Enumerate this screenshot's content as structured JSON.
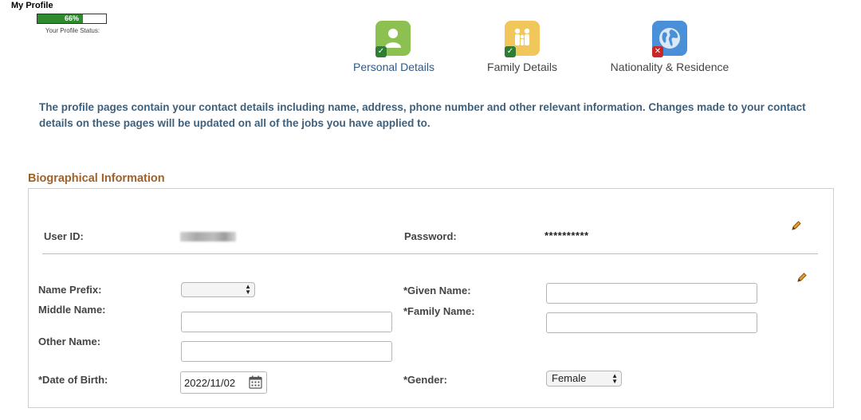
{
  "header": {
    "title": "My Profile",
    "progress_percent": 66,
    "progress_label": "66%",
    "status_label": "Your Profile Status:"
  },
  "steps": [
    {
      "label": "Personal Details",
      "icon": "person-icon",
      "status": "complete",
      "color": "#8cc152"
    },
    {
      "label": "Family Details",
      "icon": "family-icon",
      "status": "complete",
      "color": "#f1c75b"
    },
    {
      "label": "Nationality & Residence",
      "icon": "globe-icon",
      "status": "incomplete",
      "color": "#4a90d9"
    }
  ],
  "intro": "The profile pages contain your contact details including name, address, phone number and other relevant information. Changes made to your contact details on these pages will be updated on all of the jobs you have applied to.",
  "section": {
    "title": "Biographical Information",
    "user_id_label": "User ID:",
    "password_label": "Password:",
    "password_value": "**********",
    "name_prefix_label": "Name Prefix:",
    "name_prefix_value": "",
    "middle_name_label": "Middle Name:",
    "middle_name_value": "",
    "other_name_label": "Other Name:",
    "other_name_value": "",
    "given_name_label": "*Given Name:",
    "given_name_value": "",
    "family_name_label": "*Family Name:",
    "family_name_value": "",
    "dob_label": "*Date of Birth:",
    "dob_value": "2022/11/02",
    "gender_label": "*Gender:",
    "gender_value": "Female"
  },
  "colors": {
    "accent_section": "#a0612a",
    "intro_text": "#3f5f7a",
    "link": "#2e5a8a",
    "progress_fill": "#2e8b2e"
  }
}
